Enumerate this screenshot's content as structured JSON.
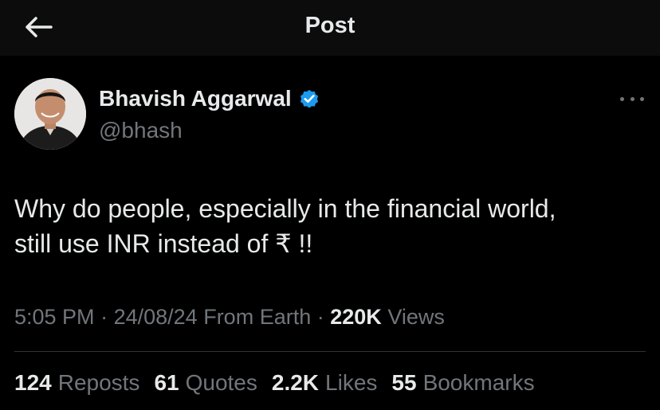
{
  "header": {
    "title": "Post",
    "back_icon": "arrow-left-icon"
  },
  "author": {
    "name": "Bhavish Aggarwal",
    "handle": "@bhash",
    "verified_icon": "verified-badge-icon",
    "verified_color": "#1d9bf0"
  },
  "post": {
    "line1": "Why do people, especially in the financial world,",
    "line2": "still use INR instead of ₹ !!",
    "time": "5:05 PM",
    "date": "24/08/24",
    "location": "From Earth",
    "views_count": "220K",
    "views_label": "Views"
  },
  "stats": {
    "reposts_count": "124",
    "reposts_label": "Reposts",
    "quotes_count": "61",
    "quotes_label": "Quotes",
    "likes_count": "2.2K",
    "likes_label": "Likes",
    "bookmarks_count": "55",
    "bookmarks_label": "Bookmarks"
  },
  "colors": {
    "background": "#000000",
    "text_primary": "#e7e9ea",
    "text_secondary": "#71767b",
    "accent": "#1d9bf0"
  }
}
